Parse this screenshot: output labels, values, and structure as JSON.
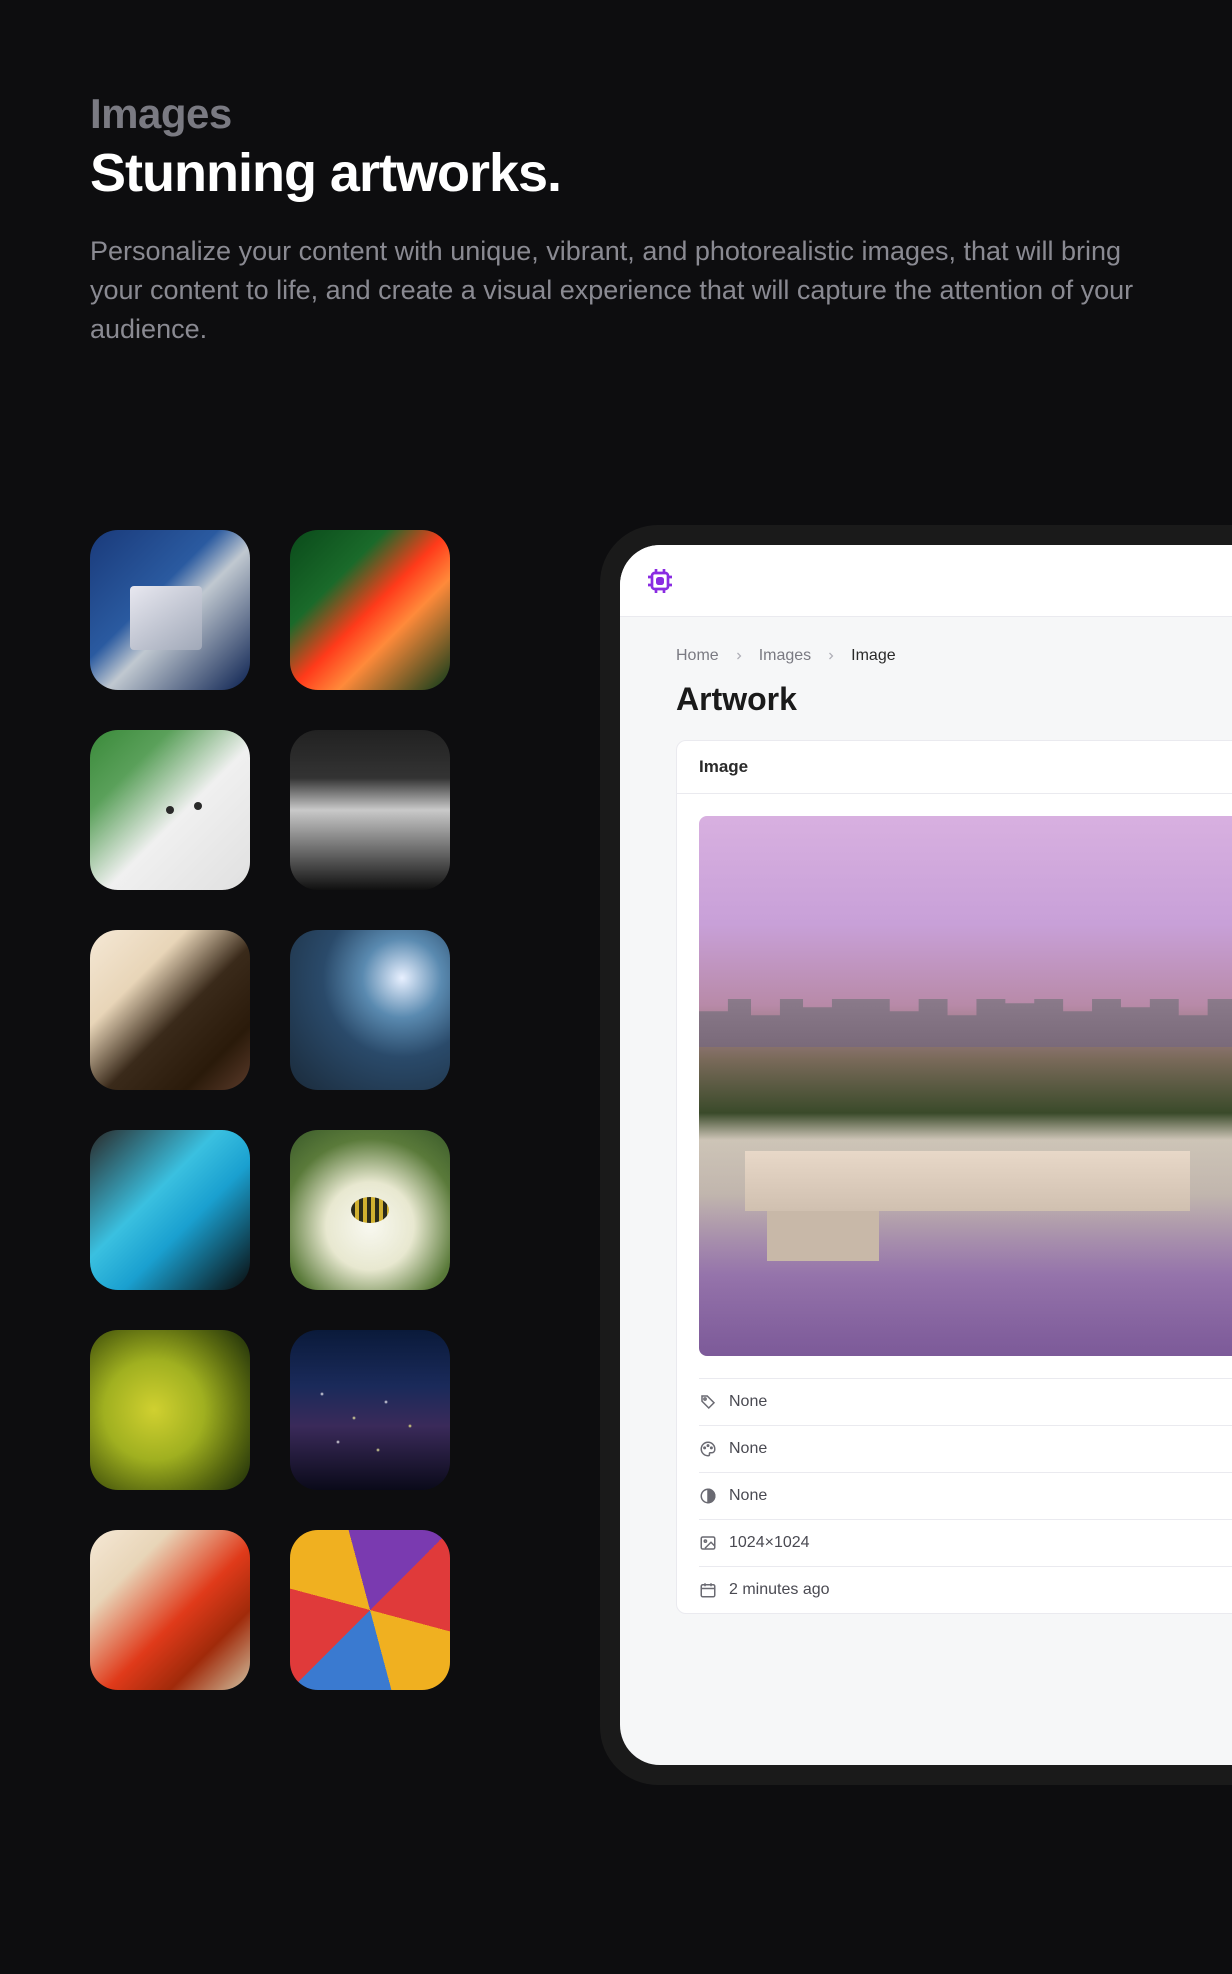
{
  "hero": {
    "eyebrow": "Images",
    "headline": "Stunning artworks.",
    "subcopy": "Personalize your content with unique, vibrant, and photorealistic images, that will bring your content to life, and create a visual experience that will capture the attention of your audience."
  },
  "thumbnails": [
    {
      "name": "motherboard"
    },
    {
      "name": "red-flower"
    },
    {
      "name": "white-cat"
    },
    {
      "name": "portrait-bw"
    },
    {
      "name": "chocolate-cake"
    },
    {
      "name": "mountain-moon"
    },
    {
      "name": "blue-car"
    },
    {
      "name": "bee-flower"
    },
    {
      "name": "green-olives"
    },
    {
      "name": "city-night"
    },
    {
      "name": "maple-leaf"
    },
    {
      "name": "umbrellas"
    }
  ],
  "app": {
    "breadcrumb": {
      "items": [
        "Home",
        "Images"
      ],
      "current": "Image"
    },
    "page_title": "Artwork",
    "card": {
      "header": "Image",
      "meta": {
        "name": "None",
        "style": "None",
        "medium": "None",
        "resolution": "1024×1024",
        "created": "2 minutes ago"
      }
    }
  }
}
